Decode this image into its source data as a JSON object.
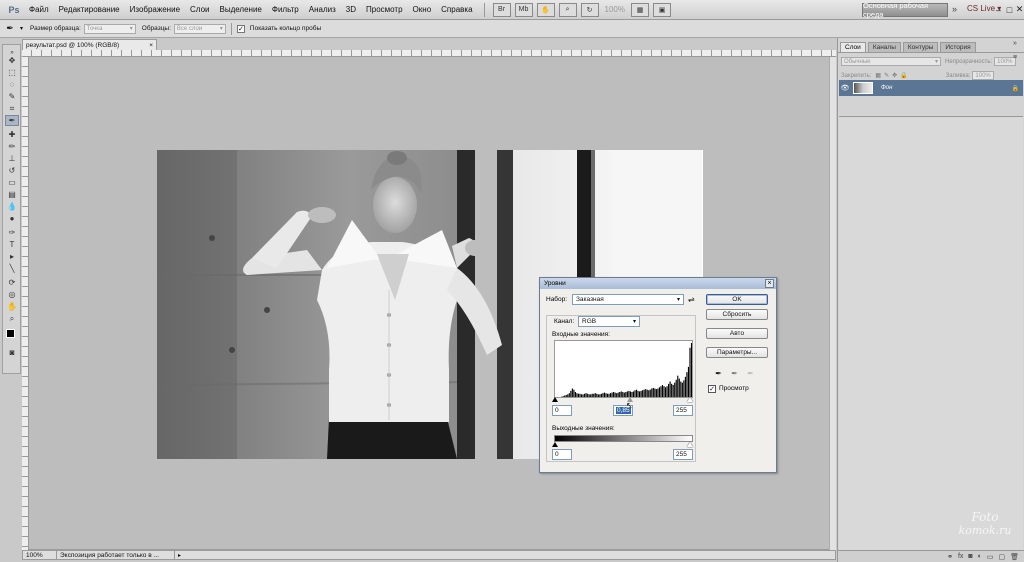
{
  "app": {
    "logo": "Ps"
  },
  "menu": [
    "Файл",
    "Редактирование",
    "Изображение",
    "Слои",
    "Выделение",
    "Фильтр",
    "Анализ",
    "3D",
    "Просмотр",
    "Окно",
    "Справка"
  ],
  "menubar": {
    "zoom": "100%",
    "workspace": "Основная рабочая среда",
    "more": "»",
    "cs_live": "CS Live ▾"
  },
  "options": {
    "sample_size_label": "Размер образца:",
    "sample_size_value": "Точка",
    "sample_label": "Образцы:",
    "sample_value": "Все слои",
    "show_ring_label": "Показать кольцо пробы",
    "show_ring_checked": true
  },
  "document": {
    "tab_title": "результат.psd @ 100% (RGB/8)",
    "tab_close": "×",
    "status_zoom": "100%",
    "status_text": "Экспозиция работает только в ..."
  },
  "layers_panel": {
    "tabs": [
      "Слои",
      "Каналы",
      "Контуры",
      "История"
    ],
    "blend_mode": "Обычные",
    "opacity_label": "Непрозрачность:",
    "opacity_value": "100%",
    "lock_label": "Закрепить:",
    "fill_label": "Заливка:",
    "fill_value": "100%",
    "layers": [
      {
        "name": "Фон"
      }
    ],
    "bottom_icons": [
      "link-icon",
      "fx-icon",
      "mask-icon",
      "adjustment-icon",
      "folder-icon",
      "new-layer-icon",
      "trash-icon"
    ]
  },
  "levels": {
    "title": "Уровни",
    "preset_label": "Набор:",
    "preset_value": "Заказная",
    "channel_label": "Канал:",
    "channel_value": "RGB",
    "input_label": "Входные значения:",
    "input_black": "0",
    "input_gamma": "0,85",
    "input_white": "255",
    "output_label": "Выходные значения:",
    "output_black": "0",
    "output_white": "255",
    "ok": "OK",
    "reset": "Сбросить",
    "auto": "Авто",
    "options": "Параметры...",
    "preview_label": "Просмотр",
    "preview_checked": true,
    "histogram": [
      2,
      2,
      3,
      3,
      4,
      5,
      6,
      7,
      8,
      10,
      14,
      18,
      16,
      12,
      10,
      9,
      9,
      8,
      8,
      9,
      10,
      9,
      8,
      8,
      9,
      9,
      10,
      9,
      8,
      8,
      9,
      10,
      11,
      10,
      9,
      9,
      10,
      11,
      12,
      11,
      10,
      11,
      12,
      13,
      12,
      11,
      12,
      13,
      14,
      13,
      12,
      13,
      15,
      16,
      14,
      13,
      14,
      15,
      16,
      17,
      16,
      15,
      16,
      18,
      19,
      18,
      17,
      18,
      20,
      22,
      24,
      22,
      20,
      22,
      26,
      30,
      26,
      24,
      28,
      33,
      40,
      35,
      30,
      28,
      32,
      38,
      46,
      55,
      88,
      96,
      40
    ]
  },
  "watermark": {
    "line1": "Foto",
    "line2": "komok.ru"
  }
}
